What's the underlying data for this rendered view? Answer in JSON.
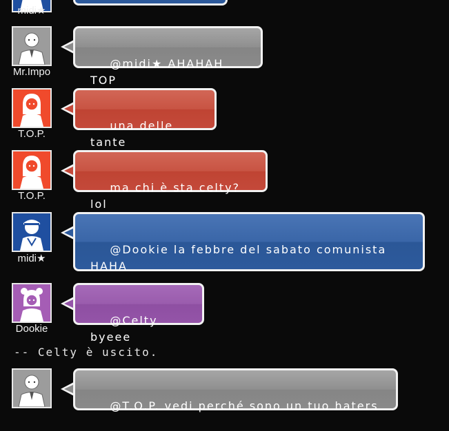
{
  "colors": {
    "blue": "#2d5a9c",
    "gray": "#8a8a8a",
    "red": "#c4493a",
    "purple": "#9454a8",
    "avatar_blue": "#1f4fa0",
    "avatar_gray": "#9c9c9c",
    "avatar_red": "#f04a2c",
    "avatar_purple": "#a55db5"
  },
  "messages": [
    {
      "user": "midi★",
      "text": "",
      "avatar_icon": "cap-person-icon",
      "color": "blue"
    },
    {
      "user": "Mr.Impo",
      "text": "@midi★ AHAHAH TOP",
      "avatar_icon": "suit-person-icon",
      "color": "gray"
    },
    {
      "user": "T.O.P.",
      "text": "una delle tante",
      "avatar_icon": "girl-bow-icon",
      "color": "red"
    },
    {
      "user": "T.O.P.",
      "text": "ma chi è sta celty? lol",
      "avatar_icon": "girl-bow-icon",
      "color": "red"
    },
    {
      "user": "midi★",
      "text": "@Dookie la febbre del sabato comunista HAHA",
      "avatar_icon": "cap-person-icon",
      "color": "blue"
    },
    {
      "user": "Dookie",
      "text": "@Celty byeee",
      "avatar_icon": "girl-buns-icon",
      "color": "purple"
    },
    {
      "user": "Mr.Impo",
      "text": "@T.O.P. vedi perché sono un tuo haters",
      "avatar_icon": "suit-person-icon",
      "color": "gray"
    }
  ],
  "system_message": "-- Celty è uscito."
}
